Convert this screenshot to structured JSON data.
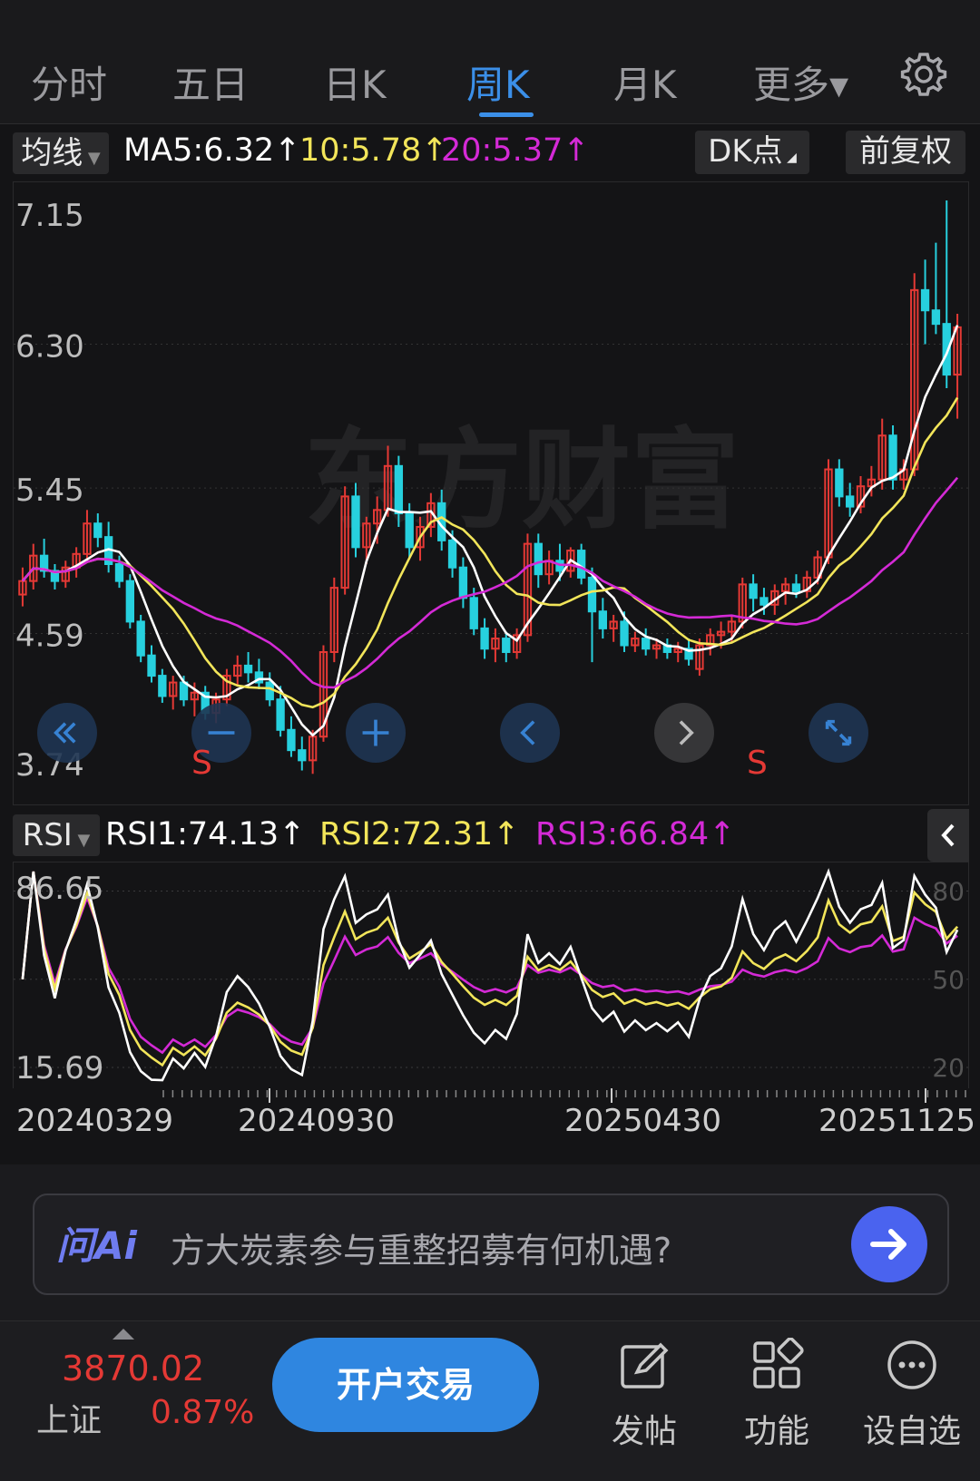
{
  "tabs": [
    {
      "label": "分时"
    },
    {
      "label": "五日"
    },
    {
      "label": "日K"
    },
    {
      "label": "周K",
      "active": true
    },
    {
      "label": "月K"
    },
    {
      "label": "更多▾"
    }
  ],
  "settings_icon": "gear-icon",
  "indicator_bar": {
    "selector": "均线",
    "ma5": "MA5:6.32↑",
    "ma10": "10:5.78↑",
    "ma20": "20:5.37↑",
    "dk_button": "DK点",
    "adjust_button": "前复权"
  },
  "colors": {
    "up": "#e53935",
    "down": "#27d0de",
    "ma5": "#ffffff",
    "ma10": "#f2e55a",
    "ma20": "#d42ad6",
    "accent": "#3b8fe8"
  },
  "price_axis": [
    "7.15",
    "6.30",
    "5.45",
    "4.59",
    "3.74"
  ],
  "watermark": "东方财富",
  "chart_controls": [
    {
      "name": "zoom-fast-back-button",
      "icon": "double-chevron-left-icon"
    },
    {
      "name": "zoom-out-button",
      "icon": "minus-icon"
    },
    {
      "name": "zoom-in-button",
      "icon": "plus-icon"
    },
    {
      "name": "scroll-left-button",
      "icon": "chevron-left-icon"
    },
    {
      "name": "scroll-right-button",
      "icon": "chevron-right-icon"
    },
    {
      "name": "fullscreen-button",
      "icon": "expand-icon"
    }
  ],
  "signal_markers": [
    "S",
    "S"
  ],
  "rsi_bar": {
    "selector": "RSI",
    "rsi1": "RSI1:74.13↑",
    "rsi2": "RSI2:72.31↑",
    "rsi3": "RSI3:66.84↑",
    "collapse_icon": "chevron-left-icon"
  },
  "rsi_axis_left": [
    "86.65",
    "15.69"
  ],
  "rsi_axis_right": [
    "80",
    "50",
    "20"
  ],
  "dates": [
    "20240329",
    "20240930",
    "20250430",
    "20251125"
  ],
  "ask_ai": {
    "logo": "问Ai",
    "prompt": "方大炭素参与重整招募有何机遇?",
    "send_icon": "arrow-right-icon"
  },
  "bottom_bar": {
    "index_value": "3870.02",
    "index_name": "上证",
    "index_change": "0.87%",
    "open_account": "开户交易",
    "nav": [
      {
        "label": "发帖",
        "icon": "edit-icon"
      },
      {
        "label": "功能",
        "icon": "grid-icon"
      },
      {
        "label": "设自选",
        "icon": "more-icon"
      }
    ]
  },
  "chart_data": [
    {
      "type": "candlestick",
      "title": "",
      "ylim": [
        3.74,
        7.15
      ],
      "yticks": [
        7.15,
        6.3,
        5.45,
        4.59,
        3.74
      ],
      "x_labels": [
        "20240329",
        "20240930",
        "20250430",
        "20251125"
      ],
      "series": [
        {
          "name": "MA5",
          "last": 6.32
        },
        {
          "name": "MA10",
          "last": 5.78
        },
        {
          "name": "MA20",
          "last": 5.37
        }
      ],
      "candles": [
        [
          4.82,
          4.98,
          4.75,
          4.9
        ],
        [
          4.9,
          5.12,
          4.85,
          5.05
        ],
        [
          5.05,
          5.15,
          4.92,
          4.96
        ],
        [
          4.96,
          5.0,
          4.85,
          4.9
        ],
        [
          4.9,
          5.02,
          4.86,
          4.98
        ],
        [
          4.98,
          5.1,
          4.92,
          5.06
        ],
        [
          5.06,
          5.32,
          5.02,
          5.24
        ],
        [
          5.24,
          5.3,
          5.1,
          5.16
        ],
        [
          5.16,
          5.25,
          4.95,
          5.0
        ],
        [
          5.0,
          5.05,
          4.86,
          4.9
        ],
        [
          4.9,
          4.94,
          4.62,
          4.66
        ],
        [
          4.66,
          4.7,
          4.42,
          4.46
        ],
        [
          4.46,
          4.52,
          4.3,
          4.34
        ],
        [
          4.34,
          4.38,
          4.18,
          4.22
        ],
        [
          4.22,
          4.34,
          4.14,
          4.3
        ],
        [
          4.3,
          4.34,
          4.16,
          4.2
        ],
        [
          4.2,
          4.3,
          4.1,
          4.24
        ],
        [
          4.24,
          4.28,
          4.08,
          4.12
        ],
        [
          4.12,
          4.24,
          4.06,
          4.2
        ],
        [
          4.2,
          4.38,
          4.16,
          4.34
        ],
        [
          4.34,
          4.46,
          4.28,
          4.4
        ],
        [
          4.4,
          4.48,
          4.3,
          4.36
        ],
        [
          4.36,
          4.44,
          4.26,
          4.3
        ],
        [
          4.3,
          4.36,
          4.16,
          4.2
        ],
        [
          4.2,
          4.28,
          3.98,
          4.02
        ],
        [
          4.02,
          4.1,
          3.86,
          3.9
        ],
        [
          3.9,
          3.98,
          3.78,
          3.84
        ],
        [
          3.84,
          4.02,
          3.76,
          3.98
        ],
        [
          3.98,
          4.52,
          3.95,
          4.48
        ],
        [
          4.48,
          4.92,
          4.42,
          4.86
        ],
        [
          4.86,
          5.46,
          4.82,
          5.4
        ],
        [
          5.4,
          5.48,
          5.04,
          5.1
        ],
        [
          5.1,
          5.28,
          5.0,
          5.24
        ],
        [
          5.24,
          5.4,
          5.12,
          5.32
        ],
        [
          5.32,
          5.7,
          5.28,
          5.58
        ],
        [
          5.58,
          5.64,
          5.22,
          5.3
        ],
        [
          5.3,
          5.36,
          5.04,
          5.1
        ],
        [
          5.1,
          5.28,
          5.02,
          5.22
        ],
        [
          5.22,
          5.42,
          5.16,
          5.36
        ],
        [
          5.36,
          5.44,
          5.08,
          5.14
        ],
        [
          5.14,
          5.2,
          4.92,
          4.98
        ],
        [
          4.98,
          5.04,
          4.74,
          4.8
        ],
        [
          4.8,
          4.86,
          4.58,
          4.62
        ],
        [
          4.62,
          4.68,
          4.44,
          4.5
        ],
        [
          4.5,
          4.62,
          4.42,
          4.56
        ],
        [
          4.56,
          4.6,
          4.42,
          4.48
        ],
        [
          4.48,
          4.62,
          4.44,
          4.58
        ],
        [
          4.58,
          5.18,
          4.54,
          5.12
        ],
        [
          5.12,
          5.18,
          4.86,
          4.94
        ],
        [
          4.94,
          5.08,
          4.88,
          5.02
        ],
        [
          5.02,
          5.12,
          4.9,
          4.96
        ],
        [
          4.96,
          5.1,
          4.92,
          5.08
        ],
        [
          5.08,
          5.12,
          4.88,
          4.92
        ],
        [
          4.92,
          4.98,
          4.42,
          4.72
        ],
        [
          4.72,
          4.8,
          4.56,
          4.62
        ],
        [
          4.62,
          4.7,
          4.54,
          4.66
        ],
        [
          4.66,
          4.72,
          4.48,
          4.52
        ],
        [
          4.52,
          4.6,
          4.48,
          4.56
        ],
        [
          4.56,
          4.62,
          4.46,
          4.5
        ],
        [
          4.5,
          4.56,
          4.44,
          4.52
        ],
        [
          4.52,
          4.56,
          4.44,
          4.48
        ],
        [
          4.48,
          4.54,
          4.42,
          4.5
        ],
        [
          4.5,
          4.56,
          4.4,
          4.44
        ],
        [
          4.38,
          4.56,
          4.34,
          4.52
        ],
        [
          4.52,
          4.62,
          4.46,
          4.58
        ],
        [
          4.58,
          4.66,
          4.5,
          4.6
        ],
        [
          4.6,
          4.7,
          4.54,
          4.66
        ],
        [
          4.66,
          4.92,
          4.62,
          4.88
        ],
        [
          4.88,
          4.94,
          4.72,
          4.8
        ],
        [
          4.8,
          4.86,
          4.7,
          4.76
        ],
        [
          4.76,
          4.88,
          4.7,
          4.84
        ],
        [
          4.84,
          4.92,
          4.76,
          4.88
        ],
        [
          4.88,
          4.94,
          4.8,
          4.84
        ],
        [
          4.84,
          4.96,
          4.8,
          4.92
        ],
        [
          4.92,
          5.08,
          4.88,
          5.04
        ],
        [
          5.04,
          5.62,
          5.0,
          5.56
        ],
        [
          5.56,
          5.62,
          5.34,
          5.4
        ],
        [
          5.4,
          5.48,
          5.28,
          5.34
        ],
        [
          5.34,
          5.52,
          5.3,
          5.46
        ],
        [
          5.46,
          5.58,
          5.4,
          5.5
        ],
        [
          5.5,
          5.86,
          5.44,
          5.76
        ],
        [
          5.76,
          5.82,
          5.44,
          5.5
        ],
        [
          5.5,
          5.62,
          5.44,
          5.56
        ],
        [
          5.56,
          6.72,
          5.52,
          6.62
        ],
        [
          6.62,
          6.8,
          6.3,
          6.5
        ],
        [
          6.5,
          6.9,
          6.36,
          6.42
        ],
        [
          6.42,
          7.15,
          6.04,
          6.12
        ],
        [
          6.12,
          6.48,
          5.86,
          6.4
        ]
      ]
    },
    {
      "type": "line",
      "title": "RSI",
      "ylim": [
        15.69,
        86.65
      ],
      "series": [
        {
          "name": "RSI1",
          "last": 74.13
        },
        {
          "name": "RSI2",
          "last": 72.31
        },
        {
          "name": "RSI3",
          "last": 66.84
        }
      ],
      "reference_lines": [
        80,
        50,
        20
      ]
    }
  ]
}
